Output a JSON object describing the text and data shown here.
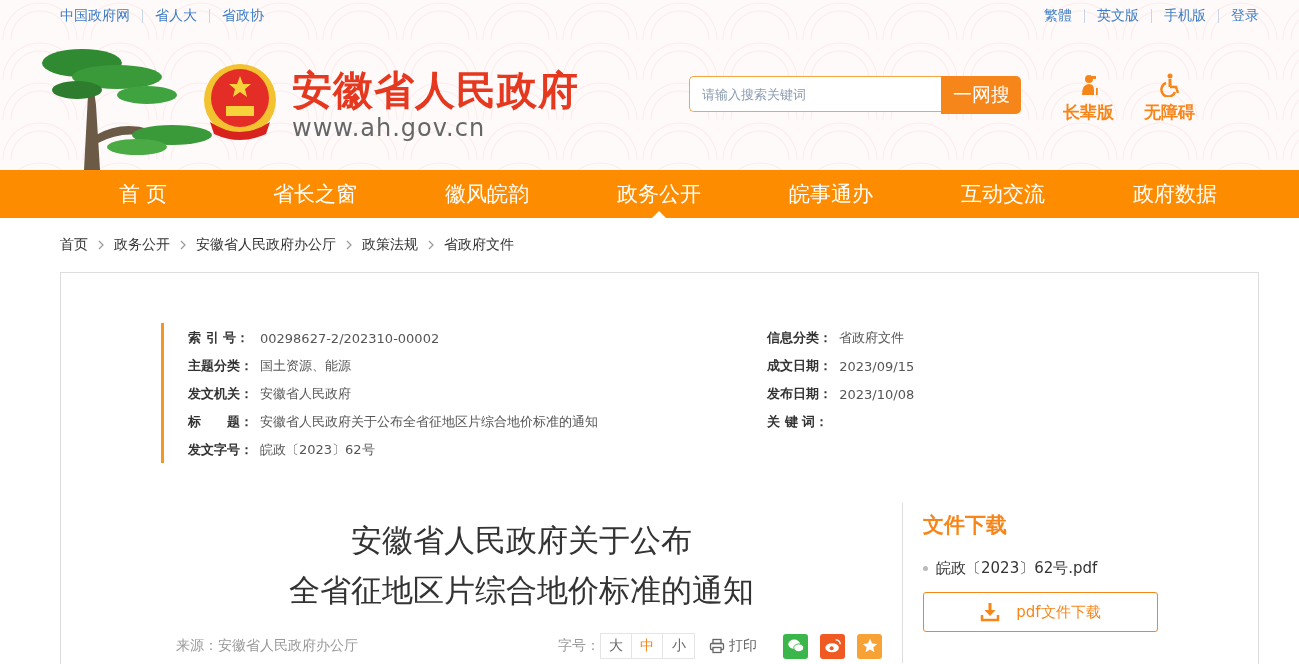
{
  "top_links": {
    "left": [
      {
        "label": "中国政府网"
      },
      {
        "label": "省人大"
      },
      {
        "label": "省政协"
      }
    ],
    "right": [
      {
        "label": "繁體"
      },
      {
        "label": "英文版"
      },
      {
        "label": "手机版"
      },
      {
        "label": "登录"
      }
    ]
  },
  "site": {
    "title": "安徽省人民政府",
    "url": "www.ah.gov.cn"
  },
  "search": {
    "placeholder": "请输入搜索关键词",
    "button": "一网搜"
  },
  "access": [
    {
      "kind": "elder",
      "label": "长辈版"
    },
    {
      "kind": "wheelchair",
      "label": "无障碍"
    }
  ],
  "nav": [
    {
      "label": "首 页",
      "selected": false
    },
    {
      "label": "省长之窗",
      "selected": false
    },
    {
      "label": "徽风皖韵",
      "selected": false
    },
    {
      "label": "政务公开",
      "selected": true
    },
    {
      "label": "皖事通办",
      "selected": false
    },
    {
      "label": "互动交流",
      "selected": false
    },
    {
      "label": "政府数据",
      "selected": false
    }
  ],
  "breadcrumb": [
    "首页",
    "政务公开",
    "安徽省人民政府办公厅",
    "政策法规",
    "省政府文件"
  ],
  "meta": {
    "left": [
      {
        "label": "索 引 号：",
        "value": "00298627-2/202310-00002"
      },
      {
        "label": "主题分类：",
        "value": "国土资源、能源"
      },
      {
        "label": "发文机关：",
        "value": "安徽省人民政府"
      },
      {
        "label": "标　　题：",
        "value": "安徽省人民政府关于公布全省征地区片综合地价标准的通知"
      },
      {
        "label": "发文字号：",
        "value": "皖政〔2023〕62号"
      }
    ],
    "right": [
      {
        "label": "信息分类：",
        "value": "省政府文件"
      },
      {
        "label": "成文日期：",
        "value": "2023/09/15"
      },
      {
        "label": "发布日期：",
        "value": "2023/10/08"
      },
      {
        "label": "关 键 词："
      }
    ]
  },
  "article": {
    "title_lines": [
      "安徽省人民政府关于公布",
      "全省征地区片综合地价标准的通知"
    ],
    "source": "来源：安徽省人民政府办公厅",
    "font_size": {
      "label": "字号：",
      "options": [
        {
          "label": "大",
          "selected": false
        },
        {
          "label": "中",
          "selected": true
        },
        {
          "label": "小",
          "selected": false
        }
      ]
    },
    "print": "打印",
    "share": [
      {
        "kind": "wechat"
      },
      {
        "kind": "weibo"
      },
      {
        "kind": "favorite"
      }
    ]
  },
  "downloads": {
    "heading": "文件下载",
    "file": "皖政〔2023〕62号.pdf",
    "button": "pdf文件下载"
  }
}
